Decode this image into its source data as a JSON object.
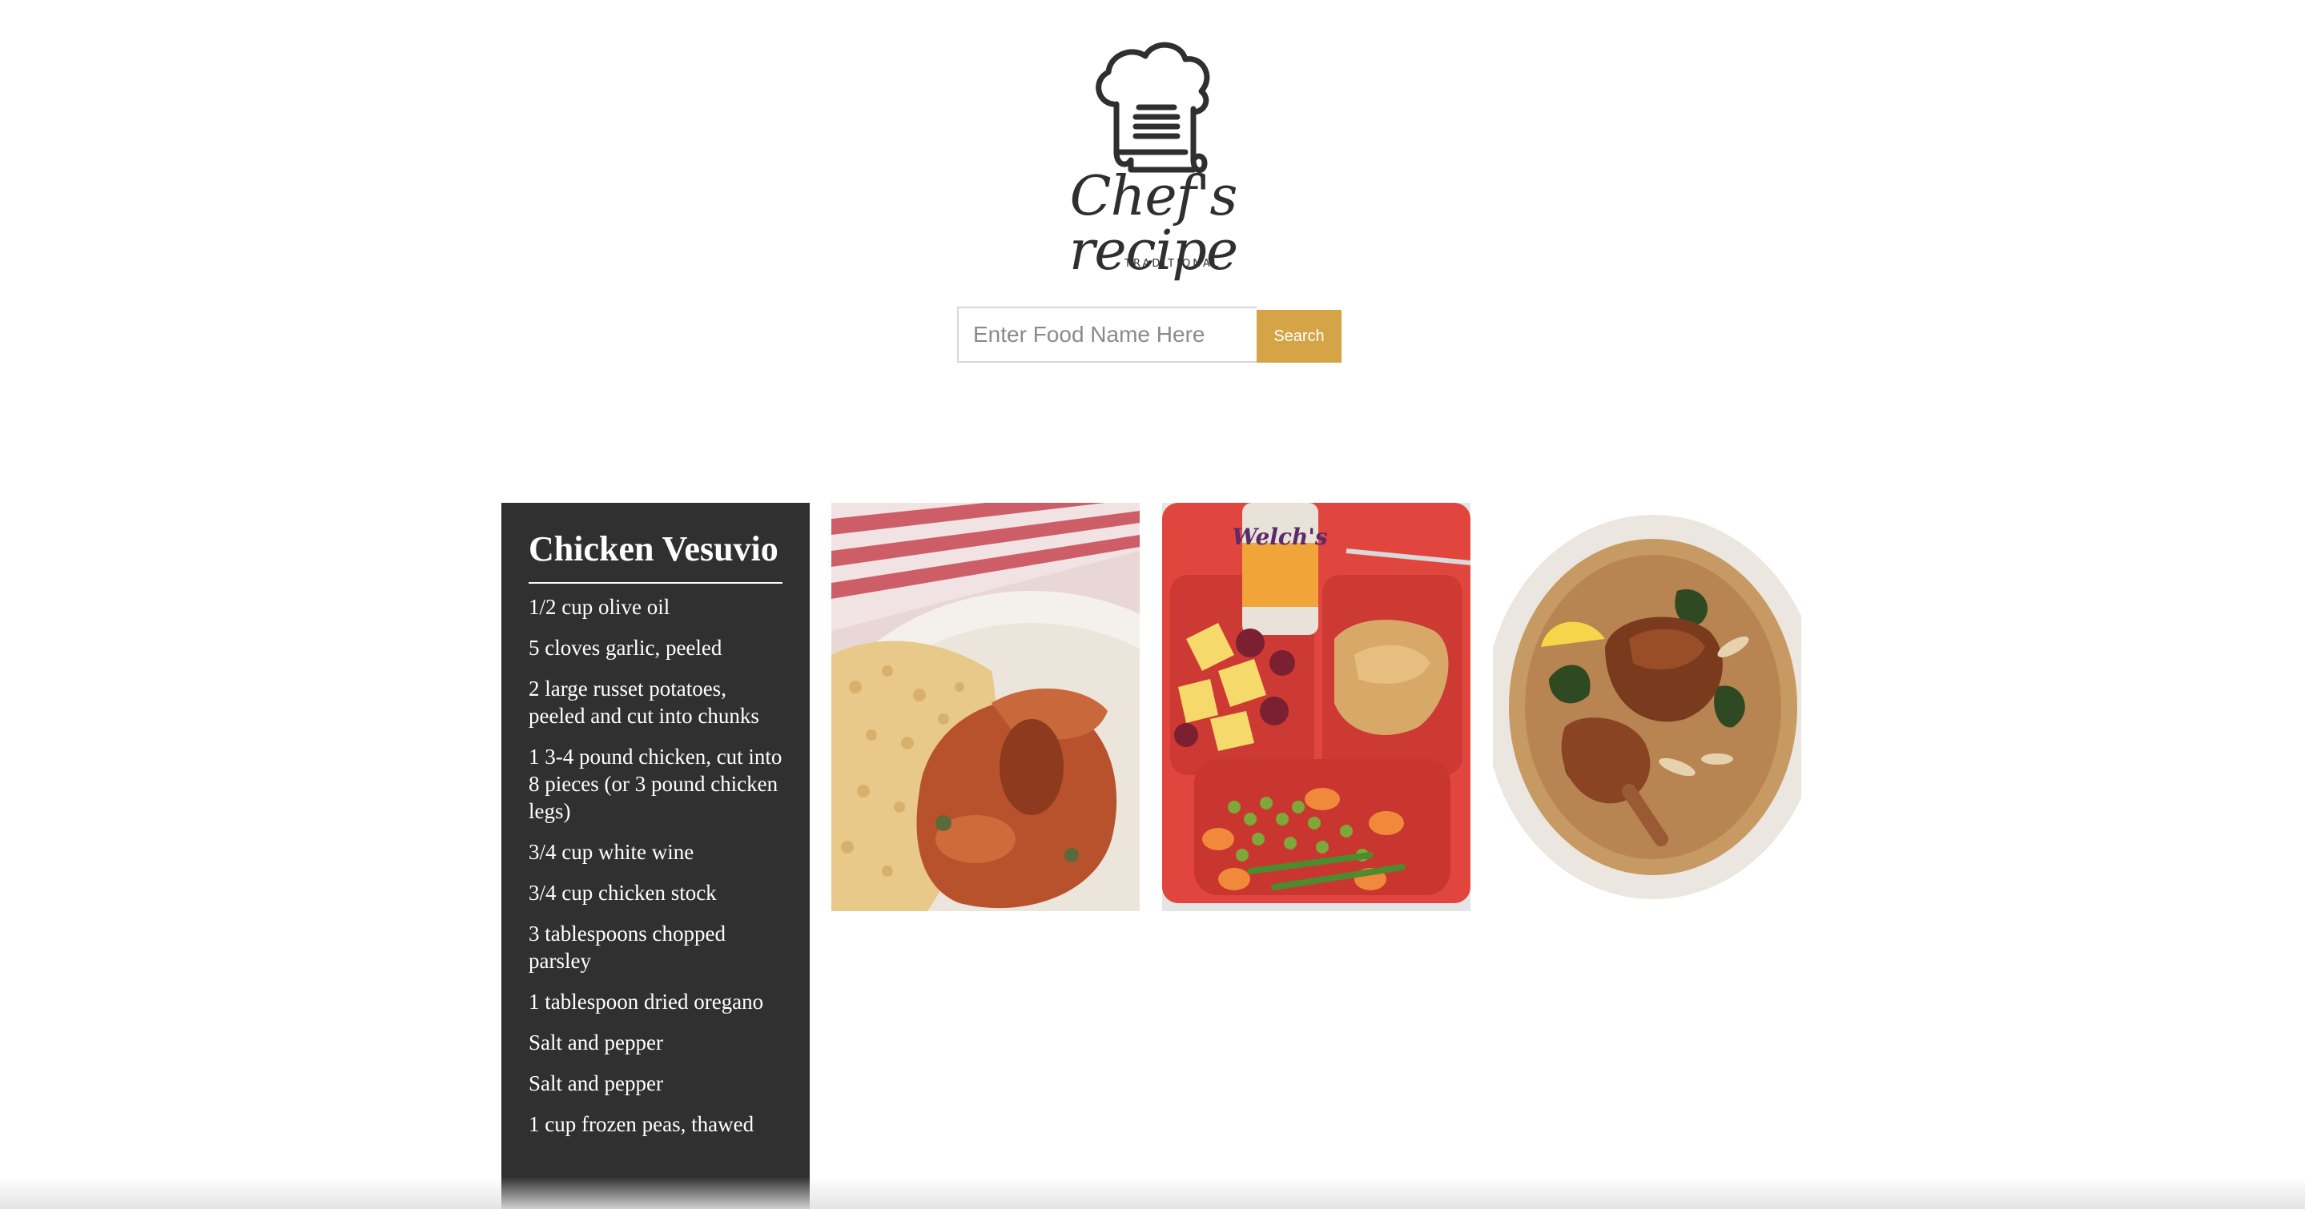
{
  "brand": {
    "name": "Chef's recipe",
    "tagline": "TRADITIONAL",
    "logo_icon": "chef-hat-recipe-scroll-icon",
    "logo_color": "#2f2f2f"
  },
  "search": {
    "placeholder": "Enter Food Name Here",
    "value": "",
    "button_label": "Search",
    "button_color": "#d4a446"
  },
  "recipe": {
    "title": "Chicken Vesuvio",
    "card_color": "#303030",
    "ingredients": [
      "1/2 cup olive oil",
      "5 cloves garlic, peeled",
      "2 large russet potatoes, peeled and cut into chunks",
      "1 3-4 pound chicken, cut into 8 pieces (or 3 pound chicken legs)",
      "3/4 cup white wine",
      "3/4 cup chicken stock",
      "3 tablespoons chopped parsley",
      "1 tablespoon dried oregano",
      "Salt and pepper",
      "Salt and pepper",
      "1 cup frozen peas, thawed"
    ]
  },
  "photos": [
    {
      "subject": "chicken-stew-with-rice-photo"
    },
    {
      "subject": "cafeteria-tray-meal-photo",
      "can_label": "Welch's"
    },
    {
      "subject": "braised-chicken-plate-photo"
    }
  ]
}
